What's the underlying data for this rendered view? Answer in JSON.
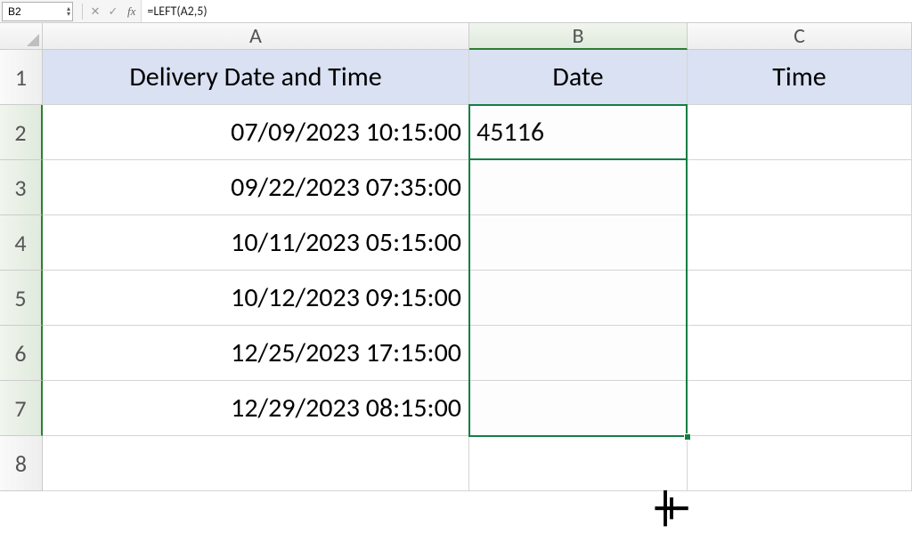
{
  "formula_bar": {
    "cell_ref": "B2",
    "formula": "=LEFT(A2,5)"
  },
  "columns": [
    "A",
    "B",
    "C"
  ],
  "active_column_index": 1,
  "rows": [
    1,
    2,
    3,
    4,
    5,
    6,
    7,
    8
  ],
  "header_row": {
    "A": "Delivery Date and Time",
    "B": "Date",
    "C": "Time"
  },
  "data": {
    "A2": "07/09/2023 10:15:00",
    "A3": "09/22/2023 07:35:00",
    "A4": "10/11/2023 05:15:00",
    "A5": "10/12/2023 09:15:00",
    "A6": "12/25/2023 17:15:00",
    "A7": "12/29/2023 08:15:00",
    "B2": "45116"
  },
  "active_cell": "B2",
  "selection": "B2:B7",
  "chart_data": {
    "type": "table",
    "columns": [
      "Delivery Date and Time",
      "Date",
      "Time"
    ],
    "rows": [
      [
        "07/09/2023 10:15:00",
        "45116",
        ""
      ],
      [
        "09/22/2023 07:35:00",
        "",
        ""
      ],
      [
        "10/11/2023 05:15:00",
        "",
        ""
      ],
      [
        "10/12/2023 09:15:00",
        "",
        ""
      ],
      [
        "12/25/2023 17:15:00",
        "",
        ""
      ],
      [
        "12/29/2023 08:15:00",
        "",
        ""
      ]
    ]
  }
}
